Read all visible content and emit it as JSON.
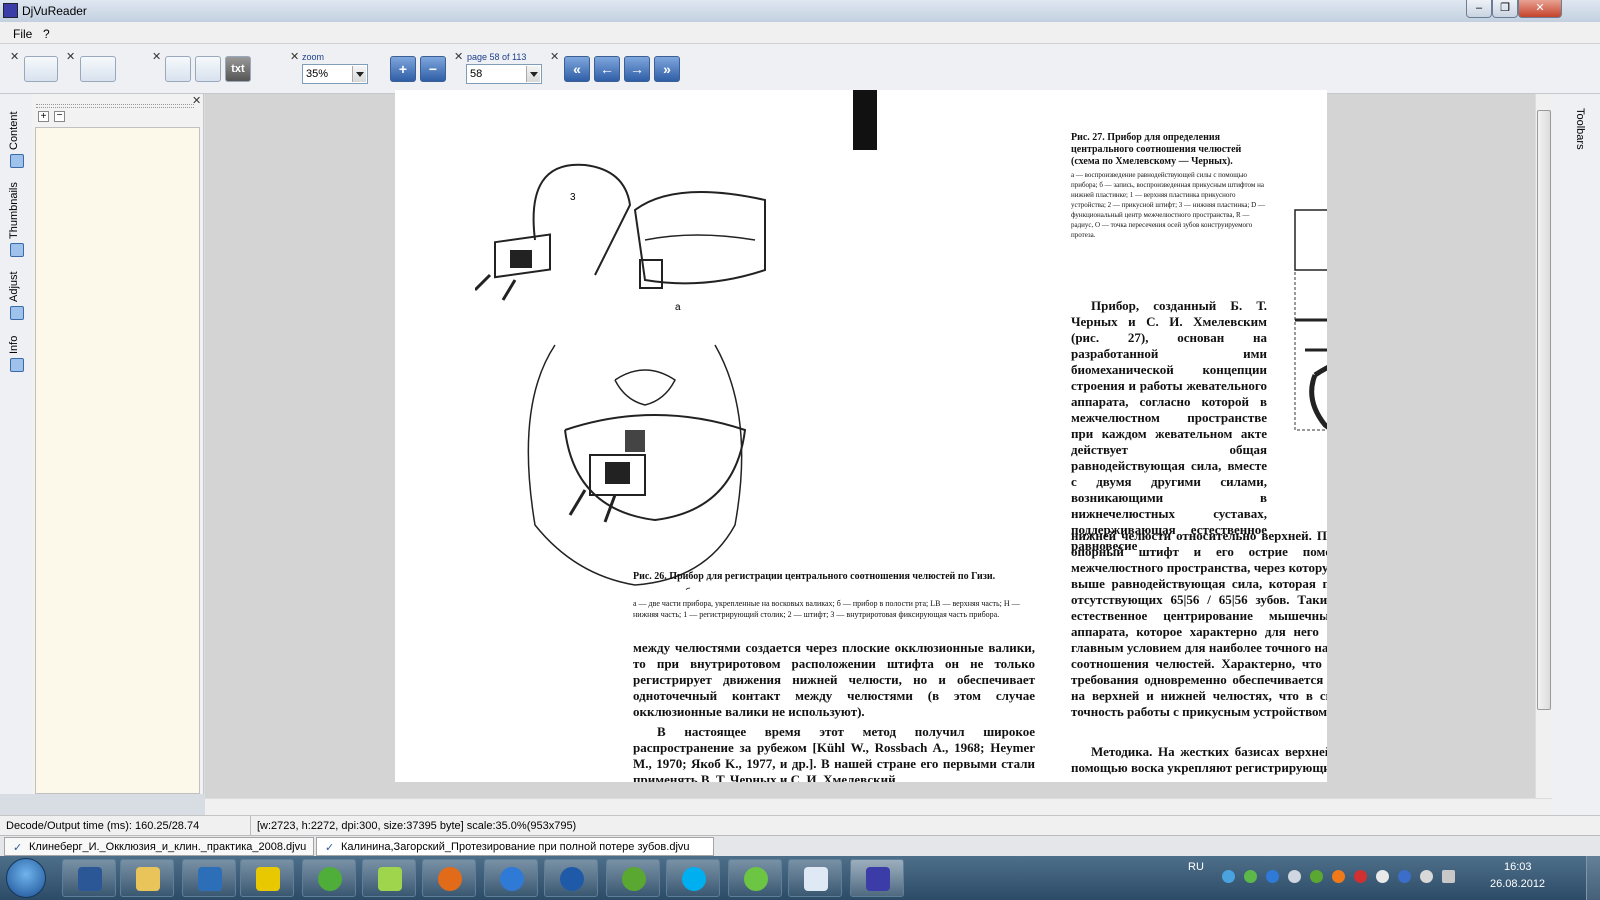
{
  "app": {
    "title": "DjVuReader"
  },
  "menu": [
    "File",
    "?"
  ],
  "toolbar": {
    "zoom_label": "zoom",
    "zoom_value": "35%",
    "page_label": "page 58 of 113",
    "page_value": "58",
    "text_button": "txt"
  },
  "left_tabs": [
    "Content",
    "Thumbnails",
    "Adjust",
    "Info"
  ],
  "right_tabs": [
    "Toolbars"
  ],
  "document": {
    "figure26_caption": "Рис. 26. Прибор для регистрации центрального соотношения челюстей по Гизи.",
    "figure26_note": "а — две части прибора, укрепленные на восковых валиках; б — прибор в полости рта; LB — верхняя часть; H — нижняя часть; 1 — регистрирующий столик; 2 — штифт; 3 — внутриротовая фиксирующая часть прибора.",
    "figure27_caption": "Рис. 27. Прибор для определения центрального соотношения челюстей (схема по Хмелевскому — Черных).",
    "figure27_note": "а — воспроизведение равнодействующей силы с помощью прибора; б — запись, воспроизведенная прикусным штифтом на нижней пластинке; 1 — верхняя пластинка прикусного устройства; 2 — прикусной штифт; 3 — нижняя пластинка; D — функциональный центр межчелюстного пространства, R — радиус, O — точка пересечения осей зубов конструируемого протеза.",
    "col_right": [
      "Прибор, созданный Б. Т. Черных и С. И. Хмелевским (рис. 27), основан на разработанной ими биомеханической концепции строения и работы жевательного аппарата, согласно которой в межчелюстном пространстве при каждом жевательном акте действует общая равнодействующая сила, вместе с двумя другими силами, возникающими в нижнечелюстных суставах, поддерживающая естественное равновесие",
      "нижней челюсти относительно верхней. При полной потере зубов опорный штифт и его острие помещают в той точке межчелюстного пространства, через которую проходит упомянутая выше равнодействующая сила, которая проецируется в области отсутствующих 65|56 / 65|56 зубов. Таким образом достигается естественное центрирование мышечных сил жевательного аппарата, которое характерно для него в норме, что является главным условием для наиболее точного нахождения центрального соотношения челюстей. Характерно, что при выполнении этого требования одновременно обеспечивается центрирование базисов на верхней и нижней челюстях, что в свою очередь повышает точность работы с прикусным устройством.",
      "Методика. На жестких базисах верхней и нижней челюстей с помощью воска укрепляют регистрирующие"
    ],
    "col_left": [
      "между челюстями создается через плоские окклюзионные валики, то при внутриротовом расположении штифта он не только регистрирует движения нижней челюсти, но и обеспечивает одноточечный контакт между челюстями (в этом случае окклюзионные валики не используют).",
      "В настоящее время этот метод получил широкое распространение за рубежом [Kühl W., Rossbach A., 1968; Heymer M., 1970; Якоб K., 1977, и др.]. В нашей стране его первыми стали применять В. Т. Черных и С. И. Хмелевский"
    ]
  },
  "status": {
    "decode": "Decode/Output time (ms): 160.25/28.74",
    "info": "[w:2723, h:2272, dpi:300, size:37395 byte] scale:35.0%(953x795)"
  },
  "doc_tabs": [
    "Клинеберг_И._Окклюзия_и_клин._практика_2008.djvu",
    "Калинина,Загорский_Протезирование при полной потере зубов.djvu"
  ],
  "taskbar": {
    "lang": "RU",
    "time": "16:03",
    "date": "26.08.2012"
  },
  "colors": {
    "accent": "#2f5ea6",
    "panel": "#fdf9ea",
    "taskbar": "#2c4b66"
  }
}
